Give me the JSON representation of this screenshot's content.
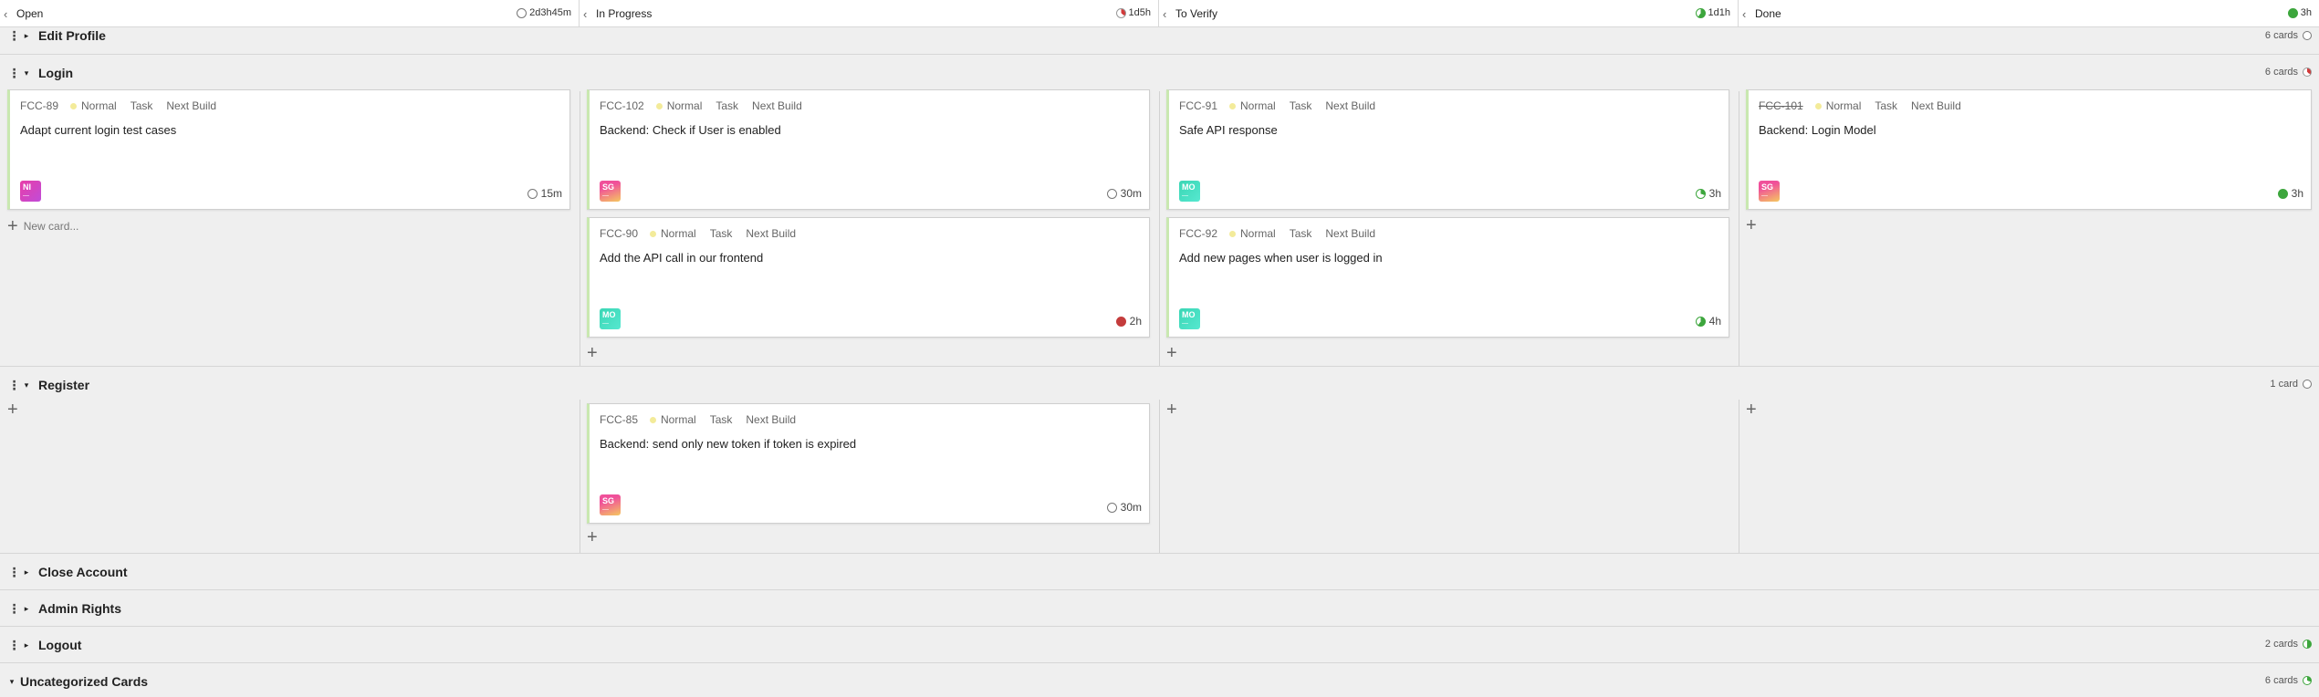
{
  "columns": [
    {
      "chev": "‹",
      "name": "Open",
      "time": "2d3h45m"
    },
    {
      "chev": "‹",
      "name": "In Progress",
      "time": "1d5h"
    },
    {
      "chev": "‹",
      "name": "To Verify",
      "time": "1d1h"
    },
    {
      "chev": "‹",
      "name": "Done",
      "time": "3h"
    }
  ],
  "lanes": {
    "edit_profile": {
      "title": "Edit Profile",
      "count": "6 cards"
    },
    "login": {
      "title": "Login",
      "count": "6 cards"
    },
    "register": {
      "title": "Register",
      "count": "1 card"
    },
    "close_account": {
      "title": "Close Account"
    },
    "admin_rights": {
      "title": "Admin Rights"
    },
    "logout": {
      "title": "Logout",
      "count": "2 cards"
    },
    "uncategorized": {
      "title": "Uncategorized Cards",
      "count": "6 cards"
    }
  },
  "cards": {
    "fcc89": {
      "key": "FCC-89",
      "priority": "Normal",
      "type": "Task",
      "sprint": "Next Build",
      "title": "Adapt current login test cases",
      "avatar": "NI",
      "estimate": "15m"
    },
    "fcc102": {
      "key": "FCC-102",
      "priority": "Normal",
      "type": "Task",
      "sprint": "Next Build",
      "title": "Backend: Check if User is enabled",
      "avatar": "SG",
      "estimate": "30m"
    },
    "fcc91": {
      "key": "FCC-91",
      "priority": "Normal",
      "type": "Task",
      "sprint": "Next Build",
      "title": "Safe API response",
      "avatar": "MO",
      "estimate": "3h"
    },
    "fcc101": {
      "key": "FCC-101",
      "priority": "Normal",
      "type": "Task",
      "sprint": "Next Build",
      "title": "Backend: Login Model",
      "avatar": "SG",
      "estimate": "3h"
    },
    "fcc90": {
      "key": "FCC-90",
      "priority": "Normal",
      "type": "Task",
      "sprint": "Next Build",
      "title": "Add the API call in our frontend",
      "avatar": "MO",
      "estimate": "2h"
    },
    "fcc92": {
      "key": "FCC-92",
      "priority": "Normal",
      "type": "Task",
      "sprint": "Next Build",
      "title": "Add new pages when user is logged in",
      "avatar": "MO",
      "estimate": "4h"
    },
    "fcc85": {
      "key": "FCC-85",
      "priority": "Normal",
      "type": "Task",
      "sprint": "Next Build",
      "title": "Backend: send only new token if token is expired",
      "avatar": "SG",
      "estimate": "30m"
    }
  },
  "new_card_label": "New card..."
}
